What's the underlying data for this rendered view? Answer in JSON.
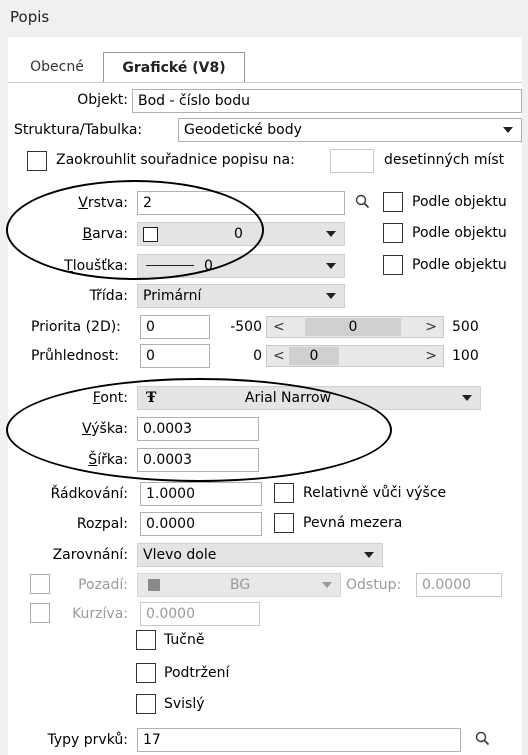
{
  "window": {
    "title": "Popis"
  },
  "tabs": {
    "general": "Obecné",
    "graphic": "Grafické (V8)"
  },
  "fields": {
    "objekt": {
      "label": "Objekt:",
      "value": "Bod - číslo bodu"
    },
    "struktura": {
      "label": "Struktura/Tabulka:",
      "value": "Geodetické body"
    },
    "zaokrouhlit": {
      "label": "Zaokrouhlit souřadnice popisu na:",
      "value": "",
      "suffix": "desetinných míst"
    },
    "vrstva": {
      "label_u": "V",
      "label_rest": "rstva:",
      "value": "2",
      "podle": "Podle objektu"
    },
    "barva": {
      "label_u": "B",
      "label_rest": "arva:",
      "value": "0",
      "podle": "Podle objektu"
    },
    "tloustka": {
      "label_u": "T",
      "label_rest": "loušťka:",
      "value": "0",
      "podle": "Podle objektu"
    },
    "trida": {
      "label": "Třída:",
      "value": "Primární"
    },
    "priorita": {
      "label": "Priorita (2D):",
      "value": "0",
      "min": "-500",
      "slider": "0",
      "max": "500"
    },
    "pruhlednost": {
      "label": "Průhlednost:",
      "value": "0",
      "min": "0",
      "slider": "0",
      "max": "100"
    },
    "font": {
      "label_u": "F",
      "label_rest": "ont:",
      "icon_glyph": "Ŧ",
      "value": "Arial Narrow"
    },
    "vyska": {
      "label_u": "V",
      "label_rest": "ýška:",
      "value": "0.0003"
    },
    "sirka": {
      "label_u": "Š",
      "label_rest": "ířka:",
      "value": "0.0003"
    },
    "radkovani": {
      "label": "Řádkování:",
      "value": "1.0000",
      "check": "Relativně vůči výšce"
    },
    "rozpal": {
      "label": "Rozpal:",
      "value": "0.0000",
      "check": "Pevná mezera"
    },
    "zarovnani": {
      "label": "Zarovnání:",
      "value": "Vlevo dole"
    },
    "pozadi": {
      "label": "Pozadí:",
      "value": "BG",
      "odstup_label": "Odstup:",
      "odstup_value": "0.0000"
    },
    "kurziva": {
      "label": "Kurzíva:",
      "value": "0.0000"
    },
    "tucne": {
      "label": "Tučně"
    },
    "podtrzeni": {
      "label": "Podtržení"
    },
    "svisly": {
      "label": "Svislý"
    },
    "typy": {
      "label": "Typy prvků:",
      "value": "17"
    }
  },
  "colors": {
    "panel": "#ffffff",
    "background": "#f0f0f0",
    "disabled": "#9a9a9a"
  }
}
